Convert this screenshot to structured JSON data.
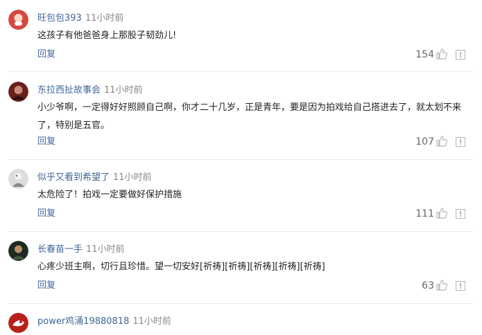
{
  "comments": [
    {
      "user": "旺包包393",
      "time": "11小时前",
      "text": "这孩子有他爸爸身上那股子韧劲儿!",
      "reply": "回复",
      "likes": "154"
    },
    {
      "user": "东拉西扯故事会",
      "time": "11小时前",
      "text": "小少爷啊，一定得好好照顾自己啊，你才二十几岁，正是青年，要是因为拍戏给自己搭进去了，就太划不来了，特别是五官。",
      "reply": "回复",
      "likes": "107"
    },
    {
      "user": "似乎又看到希望了",
      "time": "11小时前",
      "text": "太危险了！拍戏一定要做好保护措施",
      "reply": "回复",
      "likes": "111"
    },
    {
      "user": "长春苗一手",
      "time": "11小时前",
      "text": "心疼少班主啊，切行且珍惜。望一切安好[祈祷][祈祷][祈祷][祈祷][祈祷]",
      "reply": "回复",
      "likes": "63"
    },
    {
      "user": "power鸡涌19880818",
      "time": "11小时前",
      "text": "",
      "reply": "",
      "likes": ""
    }
  ],
  "colors": {
    "username": "#406599",
    "time": "#888888",
    "reply": "#406599",
    "likes": "#666666",
    "divider": "#e8e8e8"
  }
}
